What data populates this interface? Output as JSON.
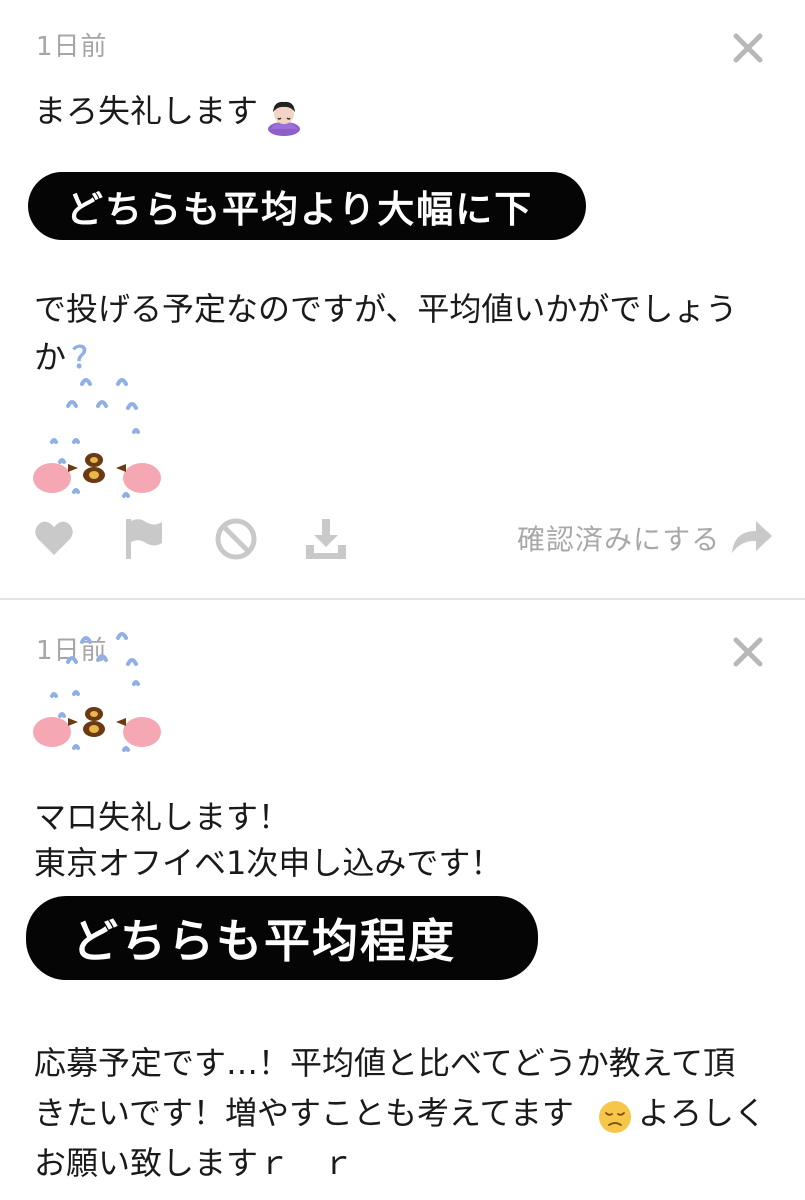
{
  "colors": {
    "muted_text": "#a6a6a6",
    "icon_gray": "#c9c9c9",
    "pill_bg": "#050505",
    "pill_text": "#ffffff",
    "blush_pink": "#f5a8b4",
    "drop_blue": "#8fb0e6",
    "face_brown": "#6b3a12"
  },
  "messages": [
    {
      "timestamp": "1日前",
      "greeting": "まろ失礼します",
      "greeting_icon": "person-bowing-emoji",
      "highlight": "どちらも平均より大幅に下",
      "body_line1": "で投げる予定なのですが、平均値いかがでしょう",
      "body_line2": "か",
      "question_mark": "？",
      "sticker": "crying-face-sticker",
      "actions": {
        "like_icon": "heart-icon",
        "report_icon": "flag-icon",
        "block_icon": "block-icon",
        "download_icon": "download-icon",
        "confirm_label": "確認済みにする",
        "share_icon": "share-arrow-icon"
      }
    },
    {
      "timestamp": "1日前",
      "sticker": "crying-face-sticker",
      "line1": "マロ失礼します！",
      "line2": "東京オフイベ1次申し込みです！",
      "highlight": "どちらも平均程度",
      "body_line1": "応募予定です…！平均値と比べてどうか教えて頂",
      "body_line2a": "きたいです！増やすことも考えてます",
      "body_line2b": "よろしく",
      "body_line3": "お願い致しますｒ　ｒ",
      "emoji": "pensive-face-emoji"
    }
  ]
}
